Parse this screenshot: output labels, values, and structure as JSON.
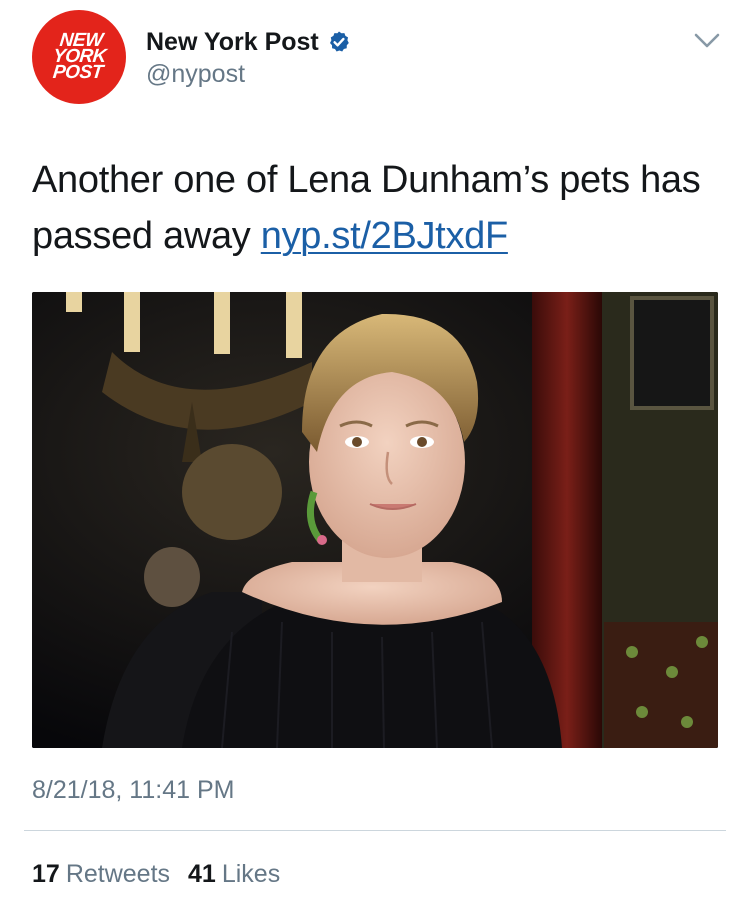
{
  "account": {
    "avatar_lines": [
      "NEW",
      "YORK",
      "POST"
    ],
    "display_name": "New York Post",
    "handle": "@nypost",
    "brand_color": "#e3241b",
    "verified_color": "#1b5fa6"
  },
  "tweet": {
    "text": "Another one of Lena Dunham’s pets has passed away ",
    "link_text": "nyp.st/2BJtxdF",
    "link_color": "#1b5fa6",
    "photo_icon": "photo-of-woman-with-short-blonde-hair-in-black-top",
    "timestamp": "8/21/18, 11:41 PM"
  },
  "stats": {
    "retweets_count": "17",
    "retweets_label": "Retweets",
    "likes_count": "41",
    "likes_label": "Likes"
  },
  "icons": {
    "verified": "verified-badge-icon",
    "menu": "chevron-down-icon"
  }
}
